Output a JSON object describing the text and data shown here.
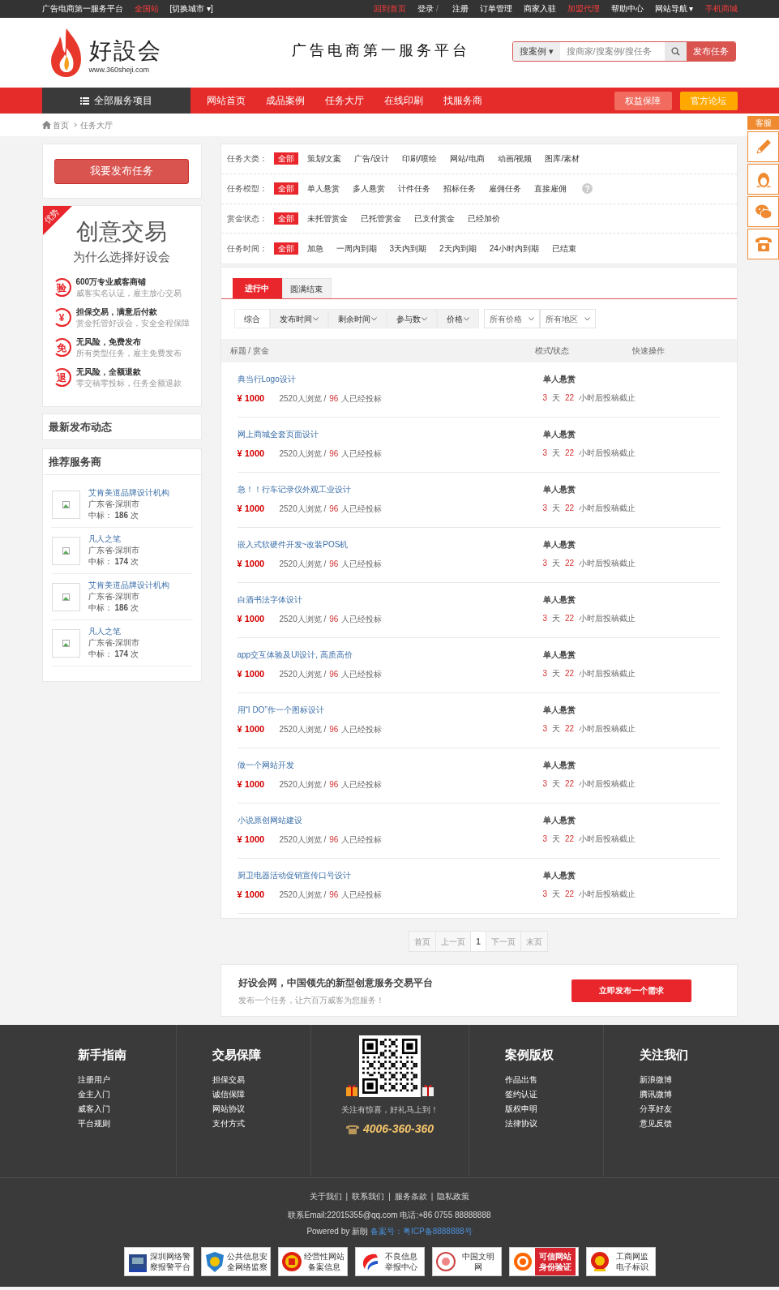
{
  "top_bar": {
    "left": [
      {
        "text": "广告电商第一服务平台",
        "kind": "link",
        "highlighted": false
      },
      {
        "text": "全国站",
        "kind": "link",
        "highlighted": true
      },
      {
        "text": "[切换城市 ▾]",
        "kind": "link",
        "highlighted": false
      }
    ],
    "right": [
      {
        "text": "回到首页",
        "kind": "link",
        "highlighted": true
      },
      {
        "text": "登录",
        "kind": "link",
        "highlighted": false
      },
      {
        "text": "/",
        "kind": "separator"
      },
      {
        "text": "注册",
        "kind": "link",
        "highlighted": false
      },
      {
        "text": "订单管理",
        "kind": "link",
        "highlighted": false
      },
      {
        "text": "商家入驻",
        "kind": "link",
        "highlighted": false
      },
      {
        "text": "加盟代理",
        "kind": "link",
        "highlighted": true
      },
      {
        "text": "帮助中心",
        "kind": "link",
        "highlighted": false
      },
      {
        "text": "网站导航 ▾",
        "kind": "link",
        "highlighted": false
      },
      {
        "text": "手机商城",
        "kind": "link",
        "highlighted": true
      }
    ]
  },
  "header": {
    "logo_name": "好設会",
    "logo_url": "www.360sheji.com",
    "slogan": "广告电商第一服务平台",
    "search": {
      "scope": "搜案例 ▾",
      "placeholder": "搜商家/搜案例/搜任务",
      "button": "发布任务"
    }
  },
  "nav": {
    "all_services": "全部服务项目",
    "items": [
      "网站首页",
      "成品案例",
      "任务大厅",
      "在线印刷",
      "找服务商"
    ],
    "buttons": [
      {
        "text": "权益保障",
        "color": "#f16b5e"
      },
      {
        "text": "官方论坛",
        "color": "#ffa900"
      }
    ]
  },
  "breadcrumb": [
    "首页",
    "任务大厅"
  ],
  "side_service": {
    "title": "客服"
  },
  "sidebar": {
    "post_button": "我要发布任务",
    "advantages": {
      "ribbon": "优势",
      "heading": "创意交易",
      "subheading": "为什么选择好设会",
      "items": [
        {
          "badge": "验",
          "title": "600万专业威客商铺",
          "desc": "威客实名认证，雇主放心交易"
        },
        {
          "badge": "¥",
          "title": "担保交易，满意后付款",
          "desc": "赏金托管好设会，安全全程保障"
        },
        {
          "badge": "免",
          "title": "无风险，免费发布",
          "desc": "所有类型任务，雇主免费发布"
        },
        {
          "badge": "退",
          "title": "无风险，全额退款",
          "desc": "零交稿零投标，任务全额退款"
        }
      ]
    },
    "latest_title": "最新发布动态",
    "providers_title": "推荐服务商",
    "providers": [
      {
        "name": "艾肯美道品牌设计机构",
        "location": "广东省-深圳市",
        "wins_label": "中标：",
        "wins": "186",
        "unit": "次"
      },
      {
        "name": "凡人之笔",
        "location": "广东省-深圳市",
        "wins_label": "中标：",
        "wins": "174",
        "unit": "次"
      },
      {
        "name": "艾肯美道品牌设计机构",
        "location": "广东省-深圳市",
        "wins_label": "中标：",
        "wins": "186",
        "unit": "次"
      },
      {
        "name": "凡人之笔",
        "location": "广东省-深圳市",
        "wins_label": "中标：",
        "wins": "174",
        "unit": "次"
      }
    ]
  },
  "filters": [
    {
      "label": "任务大类：",
      "help": false,
      "options": [
        {
          "text": "全部",
          "selected": true
        },
        {
          "text": "策划/文案",
          "selected": false
        },
        {
          "text": "广告/设计",
          "selected": false
        },
        {
          "text": "印刷/喷绘",
          "selected": false
        },
        {
          "text": "网站/电商",
          "selected": false
        },
        {
          "text": "动画/视频",
          "selected": false
        },
        {
          "text": "图库/素材",
          "selected": false
        }
      ]
    },
    {
      "label": "任务模型：",
      "help": true,
      "options": [
        {
          "text": "全部",
          "selected": true
        },
        {
          "text": "单人悬赏",
          "selected": false
        },
        {
          "text": "多人悬赏",
          "selected": false
        },
        {
          "text": "计件任务",
          "selected": false
        },
        {
          "text": "招标任务",
          "selected": false
        },
        {
          "text": "雇佣任务",
          "selected": false
        },
        {
          "text": "直接雇佣",
          "selected": false
        }
      ]
    },
    {
      "label": "赏金状态：",
      "help": false,
      "options": [
        {
          "text": "全部",
          "selected": true
        },
        {
          "text": "未托管赏金",
          "selected": false
        },
        {
          "text": "已托管赏金",
          "selected": false
        },
        {
          "text": "已支付赏金",
          "selected": false
        },
        {
          "text": "已经加价",
          "selected": false
        }
      ]
    },
    {
      "label": "任务时间：",
      "help": false,
      "options": [
        {
          "text": "全部",
          "selected": true
        },
        {
          "text": "加急",
          "selected": false
        },
        {
          "text": "一周内到期",
          "selected": false
        },
        {
          "text": "3天内到期",
          "selected": false
        },
        {
          "text": "2天内到期",
          "selected": false
        },
        {
          "text": "24小时内到期",
          "selected": false
        },
        {
          "text": "已结束",
          "selected": false
        }
      ]
    }
  ],
  "tabs": [
    {
      "label": "进行中",
      "selected": true
    },
    {
      "label": "圆满结束",
      "selected": false
    }
  ],
  "sort": [
    {
      "text": "综合",
      "dropdown": false,
      "selected": true
    },
    {
      "text": "发布时间",
      "dropdown": true,
      "selected": false
    },
    {
      "text": "剩余时间",
      "dropdown": true,
      "selected": false
    },
    {
      "text": "参与数",
      "dropdown": true,
      "selected": false
    },
    {
      "text": "价格",
      "dropdown": true,
      "selected": false
    }
  ],
  "selects": [
    "所有价格",
    "所有地区"
  ],
  "table": {
    "columns": [
      "标题 / 赏金",
      "模式/状态",
      "快速操作"
    ],
    "rows": [
      {
        "title": "典当行Logo设计",
        "price": "¥ 1000",
        "views": "2520人浏览 /",
        "bids": "96",
        "bids_label": "人已经投标",
        "mode": "单人悬赏",
        "days": "3",
        "days_unit": "天",
        "hours": "22",
        "deadline": "小时后投稿截止"
      },
      {
        "title": "网上商城全套页面设计",
        "price": "¥ 1000",
        "views": "2520人浏览 /",
        "bids": "96",
        "bids_label": "人已经投标",
        "mode": "单人悬赏",
        "days": "3",
        "days_unit": "天",
        "hours": "22",
        "deadline": "小时后投稿截止"
      },
      {
        "title": "急！！行车记录仪外观工业设计",
        "price": "¥ 1000",
        "views": "2520人浏览 /",
        "bids": "96",
        "bids_label": "人已经投标",
        "mode": "单人悬赏",
        "days": "3",
        "days_unit": "天",
        "hours": "22",
        "deadline": "小时后投稿截止"
      },
      {
        "title": "嵌入式软硬件开发~改装POS机",
        "price": "¥ 1000",
        "views": "2520人浏览 /",
        "bids": "96",
        "bids_label": "人已经投标",
        "mode": "单人悬赏",
        "days": "3",
        "days_unit": "天",
        "hours": "22",
        "deadline": "小时后投稿截止"
      },
      {
        "title": "白酒书法字体设计",
        "price": "¥ 1000",
        "views": "2520人浏览 /",
        "bids": "96",
        "bids_label": "人已经投标",
        "mode": "单人悬赏",
        "days": "3",
        "days_unit": "天",
        "hours": "22",
        "deadline": "小时后投稿截止"
      },
      {
        "title": "app交互体验及UI设计, 高质高价",
        "price": "¥ 1000",
        "views": "2520人浏览 /",
        "bids": "96",
        "bids_label": "人已经投标",
        "mode": "单人悬赏",
        "days": "3",
        "days_unit": "天",
        "hours": "22",
        "deadline": "小时后投稿截止"
      },
      {
        "title": "用“I DO”作一个图标设计",
        "price": "¥ 1000",
        "views": "2520人浏览 /",
        "bids": "96",
        "bids_label": "人已经投标",
        "mode": "单人悬赏",
        "days": "3",
        "days_unit": "天",
        "hours": "22",
        "deadline": "小时后投稿截止"
      },
      {
        "title": "做一个网站开发",
        "price": "¥ 1000",
        "views": "2520人浏览 /",
        "bids": "96",
        "bids_label": "人已经投标",
        "mode": "单人悬赏",
        "days": "3",
        "days_unit": "天",
        "hours": "22",
        "deadline": "小时后投稿截止"
      },
      {
        "title": "小说原创网站建设",
        "price": "¥ 1000",
        "views": "2520人浏览 /",
        "bids": "96",
        "bids_label": "人已经投标",
        "mode": "单人悬赏",
        "days": "3",
        "days_unit": "天",
        "hours": "22",
        "deadline": "小时后投稿截止"
      },
      {
        "title": "厨卫电器活动促销宣传口号设计",
        "price": "¥ 1000",
        "views": "2520人浏览 /",
        "bids": "96",
        "bids_label": "人已经投标",
        "mode": "单人悬赏",
        "days": "3",
        "days_unit": "天",
        "hours": "22",
        "deadline": "小时后投稿截止"
      }
    ]
  },
  "pagination": [
    {
      "text": "首页",
      "selected": false
    },
    {
      "text": "上一页",
      "selected": false
    },
    {
      "text": "1",
      "selected": true
    },
    {
      "text": "下一页",
      "selected": false
    },
    {
      "text": "末页",
      "selected": false
    }
  ],
  "cta": {
    "title": "好设会网，中国领先的新型创意服务交易平台",
    "subtitle": "发布一个任务，让六百万威客为您服务！",
    "button": "立即发布一个需求"
  },
  "footer": {
    "columns_left": [
      {
        "title": "新手指南",
        "links": [
          "注册用户",
          "金主入门",
          "威客入门",
          "平台规则"
        ]
      },
      {
        "title": "交易保障",
        "links": [
          "担保交易",
          "诚信保障",
          "网站协议",
          "支付方式"
        ]
      }
    ],
    "qr": {
      "caption": "关注有惊喜，好礼马上到！",
      "phone": "4006-360-360"
    },
    "columns_right": [
      {
        "title": "案例版权",
        "links": [
          "作品出售",
          "签约认证",
          "版权申明",
          "法律协议"
        ]
      },
      {
        "title": "关注我们",
        "links": [
          "新浪微博",
          "腾讯微博",
          "分享好友",
          "意见反馈"
        ]
      }
    ],
    "bottom_links": [
      {
        "text": "关于我们",
        "kind": "link"
      },
      {
        "text": "|",
        "kind": "separator"
      },
      {
        "text": "联系我们",
        "kind": "link"
      },
      {
        "text": "|",
        "kind": "separator"
      },
      {
        "text": "服务条款",
        "kind": "link"
      },
      {
        "text": "|",
        "kind": "separator"
      },
      {
        "text": "隐私政策",
        "kind": "link"
      }
    ],
    "contact": "联系Email:22015355@qq.com 电话:+86 0755 88888888",
    "powered": "Powered by 新朗",
    "icp": "备案号：粤ICP备8888888号",
    "badges": [
      {
        "kind": "plain",
        "lines": [
          "深圳网络警",
          "察报警平台"
        ]
      },
      {
        "kind": "plain",
        "lines": [
          "公共信息安",
          "全网络监察"
        ]
      },
      {
        "kind": "plain",
        "lines": [
          "经营性网站",
          "备案信息"
        ]
      },
      {
        "kind": "plain",
        "lines": [
          "不良信息",
          "举报中心"
        ]
      },
      {
        "kind": "plain",
        "lines": [
          "中国文明",
          "网"
        ]
      },
      {
        "kind": "inverse",
        "lines": [
          "可信网站",
          "身份验证"
        ]
      },
      {
        "kind": "plain",
        "lines": [
          "工商网监",
          "电子标识"
        ]
      }
    ]
  }
}
